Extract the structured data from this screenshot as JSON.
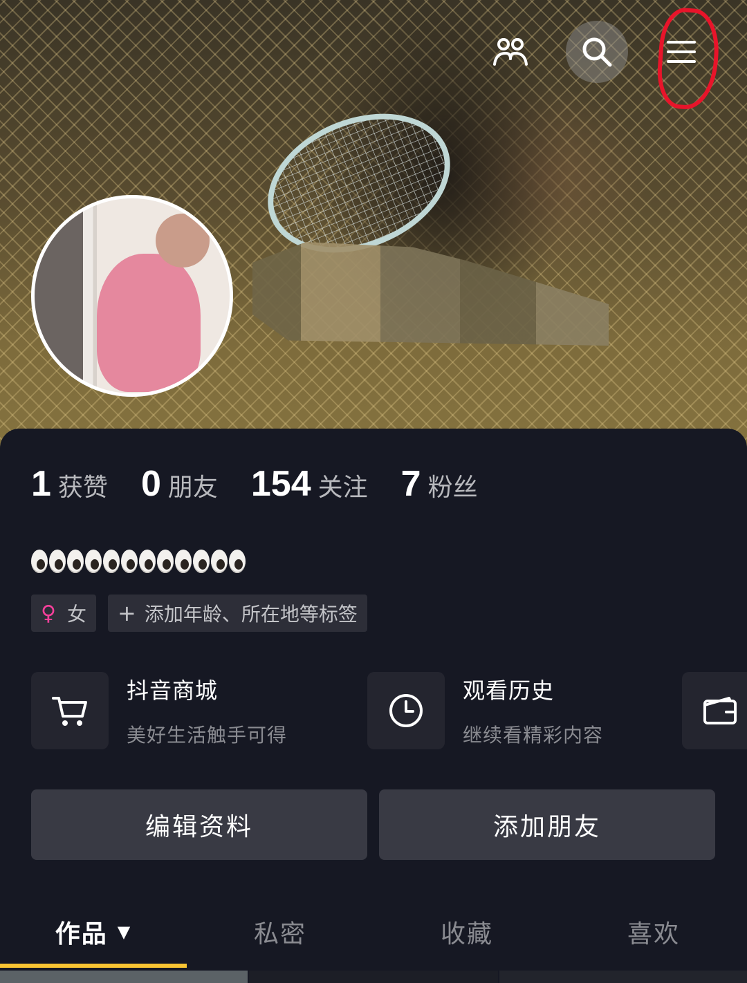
{
  "header": {
    "icons": [
      "friends-icon",
      "search-icon",
      "menu-icon"
    ]
  },
  "profile": {
    "bio_emojis": "👀👀👀👀👀👀"
  },
  "stats": [
    {
      "value": "1",
      "label": "获赞"
    },
    {
      "value": "0",
      "label": "朋友"
    },
    {
      "value": "154",
      "label": "关注"
    },
    {
      "value": "7",
      "label": "粉丝"
    }
  ],
  "tags": {
    "gender_symbol": "♀",
    "gender": "女",
    "add_tags_plus": "+",
    "add_tags": "添加年龄、所在地等标签"
  },
  "shortcuts": [
    {
      "icon": "cart-icon",
      "title": "抖音商城",
      "subtitle": "美好生活触手可得"
    },
    {
      "icon": "clock-icon",
      "title": "观看历史",
      "subtitle": "继续看精彩内容"
    },
    {
      "icon": "wallet-icon"
    }
  ],
  "actions": {
    "edit_profile": "编辑资料",
    "add_friend": "添加朋友"
  },
  "tabs": [
    {
      "label": "作品",
      "caret": "▼",
      "active": true
    },
    {
      "label": "私密"
    },
    {
      "label": "收藏"
    },
    {
      "label": "喜欢"
    }
  ],
  "colors": {
    "background": "#161823",
    "tab_indicator": "#f8c433",
    "female_pink": "#f6409b",
    "highlight_red": "#e8142a"
  }
}
